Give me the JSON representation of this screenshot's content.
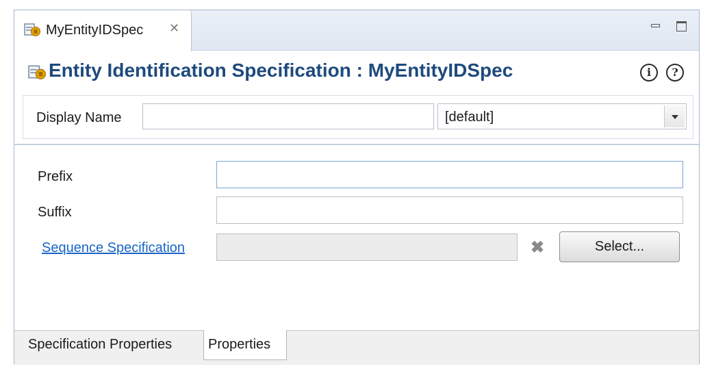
{
  "editor_tab": {
    "label": "MyEntityIDSpec",
    "icon": "entity-spec-icon"
  },
  "window_controls": {
    "minimize_icon": "minimize-icon",
    "maximize_icon": "maximize-icon"
  },
  "header": {
    "title": "Entity Identification Specification : MyEntityIDSpec",
    "info_symbol": "i",
    "help_symbol": "?"
  },
  "display_name": {
    "label": "Display Name",
    "value": "",
    "locale_selected": "[default]"
  },
  "form": {
    "prefix_label": "Prefix",
    "prefix_value": "",
    "suffix_label": "Suffix",
    "suffix_value": "",
    "sequence_link": "Sequence Specification",
    "sequence_value": "",
    "select_button": "Select..."
  },
  "bottom_tabs": [
    "Specification Properties",
    "Properties"
  ],
  "colors": {
    "title": "#1e4a7d",
    "link": "#1a64c6",
    "accent_icon": "#e7a400"
  }
}
